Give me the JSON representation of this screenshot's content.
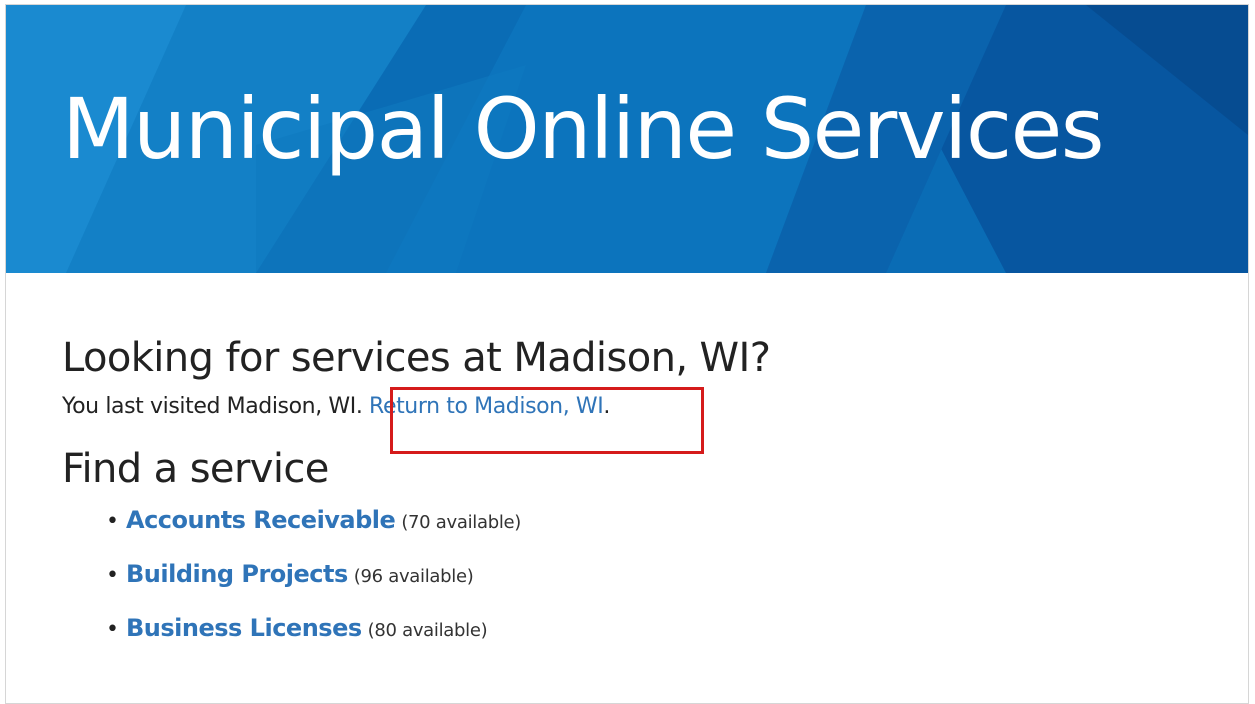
{
  "banner": {
    "title": "Municipal Online Services",
    "colors": {
      "base": "#0a6cb5",
      "light": "#1a8ad0",
      "dark": "#0756a0"
    }
  },
  "location": {
    "heading": "Looking for services at Madison, WI?",
    "visited_text": "You last visited Madison, WI.",
    "return_link": "Return to Madison, WI",
    "return_suffix": "."
  },
  "services": {
    "heading": "Find a service",
    "bullet": "•",
    "items": [
      {
        "name": "Accounts Receivable",
        "count": "(70 available)"
      },
      {
        "name": "Building Projects",
        "count": "(96 available)"
      },
      {
        "name": "Business Licenses",
        "count": "(80 available)"
      }
    ]
  },
  "accent_colors": {
    "link": "#2f74b8",
    "highlight": "#d51b1b"
  }
}
